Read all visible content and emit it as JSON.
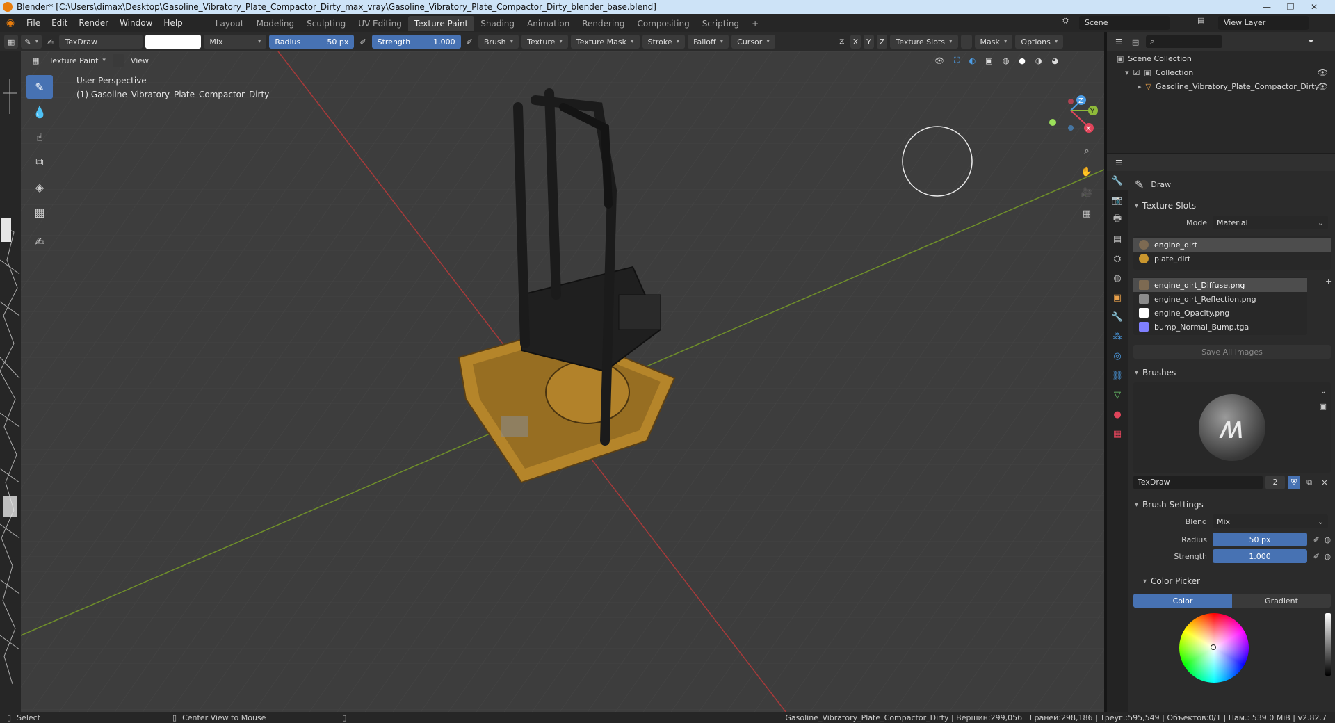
{
  "window": {
    "title": "Blender* [C:\\Users\\dimax\\Desktop\\Gasoline_Vibratory_Plate_Compactor_Dirty_max_vray\\Gasoline_Vibratory_Plate_Compactor_Dirty_blender_base.blend]",
    "controls": [
      "—",
      "❐",
      "✕"
    ]
  },
  "menubar": {
    "menus": [
      "File",
      "Edit",
      "Render",
      "Window",
      "Help"
    ],
    "workspaces": [
      "Layout",
      "Modeling",
      "Sculpting",
      "UV Editing",
      "Texture Paint",
      "Shading",
      "Animation",
      "Rendering",
      "Compositing",
      "Scripting"
    ],
    "active_workspace": "Texture Paint",
    "add_tab": "+",
    "scene_label": "Scene",
    "view_layer_label": "View Layer"
  },
  "toolheader": {
    "brush_name": "TexDraw",
    "color_hex": "#ffffff",
    "blend": "Mix",
    "radius_label": "Radius",
    "radius_value": "50 px",
    "strength_label": "Strength",
    "strength_value": "1.000",
    "menus": [
      "Brush",
      "Texture",
      "Texture Mask",
      "Stroke",
      "Falloff",
      "Cursor"
    ],
    "axes": [
      "X",
      "Y",
      "Z"
    ],
    "texture_slots": "Texture Slots",
    "mask": "Mask",
    "options": "Options"
  },
  "viewheader": {
    "mode": "Texture Paint",
    "view": "View"
  },
  "viewport": {
    "perspective": "User Perspective",
    "object": "(1) Gasoline_Vibratory_Plate_Compactor_Dirty",
    "gizmo_axes": [
      "X",
      "Y",
      "Z"
    ]
  },
  "outliner": {
    "root": "Scene Collection",
    "collection": "Collection",
    "object": "Gasoline_Vibratory_Plate_Compactor_Dirty"
  },
  "properties": {
    "tool_name": "Draw",
    "texture_slots": {
      "header": "Texture Slots",
      "mode_label": "Mode",
      "mode_value": "Material",
      "materials": [
        "engine_dirt",
        "plate_dirt"
      ],
      "selected_material": "engine_dirt",
      "images": [
        {
          "name": "engine_dirt_Diffuse.png",
          "color": "#7d6a52"
        },
        {
          "name": "engine_dirt_Reflection.png",
          "color": "#8c8c8c"
        },
        {
          "name": "engine_Opacity.png",
          "color": "#ffffff"
        },
        {
          "name": "bump_Normal_Bump.tga",
          "color": "#8080ff"
        }
      ],
      "selected_image": "engine_dirt_Diffuse.png",
      "save_all": "Save All Images"
    },
    "brushes": {
      "header": "Brushes",
      "brush_name": "TexDraw",
      "users": "2"
    },
    "brush_settings": {
      "header": "Brush Settings",
      "blend_label": "Blend",
      "blend_value": "Mix",
      "radius_label": "Radius",
      "radius_value": "50 px",
      "strength_label": "Strength",
      "strength_value": "1.000",
      "color_picker_header": "Color Picker",
      "tab_color": "Color",
      "tab_gradient": "Gradient"
    }
  },
  "statusbar": {
    "left1": "Select",
    "left2": "Center View to Mouse",
    "right": "Gasoline_Vibratory_Plate_Compactor_Dirty | Вершин:299,056 | Граней:298,186 | Треуг.:595,549 | Объектов:0/1 | Пам.: 539.0 MiB | v2.82.7"
  },
  "colors": {
    "accent": "#4772b3",
    "x_axis": "#a83a3a",
    "y_axis": "#6f8f2a",
    "plate": "#c9962e"
  }
}
